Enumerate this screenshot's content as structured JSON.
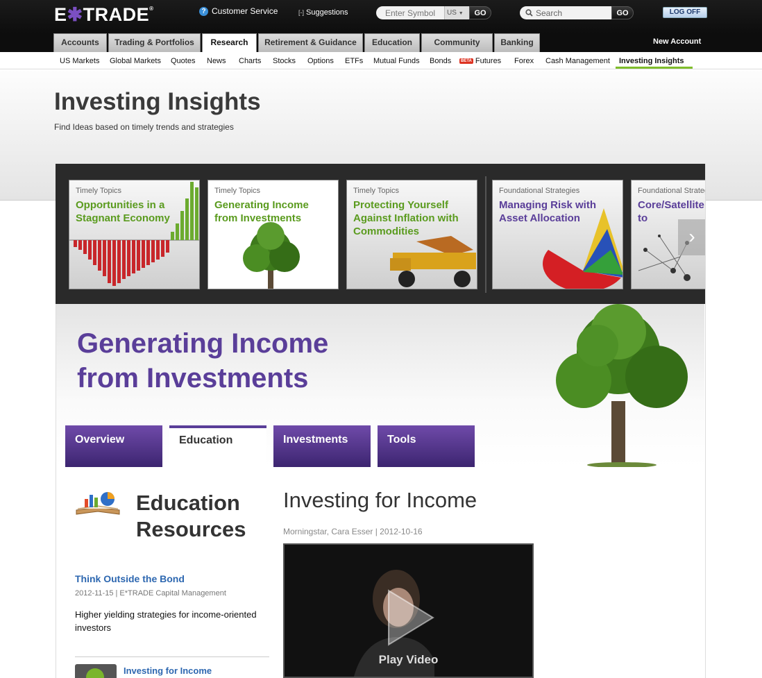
{
  "header": {
    "logo": "E*TRADE",
    "customer_service": "Customer Service",
    "suggestions": "Suggestions",
    "symbol_placeholder": "Enter Symbol",
    "symbol_market": "US",
    "go_label": "GO",
    "search_placeholder": "Search",
    "search_go_label": "GO",
    "logoff_label": "LOG OFF"
  },
  "nav": {
    "tabs": [
      {
        "label": "Accounts"
      },
      {
        "label": "Trading & Portfolios"
      },
      {
        "label": "Research"
      },
      {
        "label": "Retirement & Guidance"
      },
      {
        "label": "Education"
      },
      {
        "label": "Community"
      },
      {
        "label": "Banking"
      }
    ],
    "new_account": "New Account",
    "active_tab": "Research"
  },
  "subnav": {
    "items": [
      {
        "label": "US Markets"
      },
      {
        "label": "Global Markets"
      },
      {
        "label": "Quotes"
      },
      {
        "label": "News"
      },
      {
        "label": "Charts"
      },
      {
        "label": "Stocks"
      },
      {
        "label": "Options"
      },
      {
        "label": "ETFs"
      },
      {
        "label": "Mutual Funds"
      },
      {
        "label": "Bonds"
      },
      {
        "label": "Futures",
        "badge": "BETA"
      },
      {
        "label": "Forex"
      },
      {
        "label": "Cash Management"
      },
      {
        "label": "Investing Insights"
      }
    ],
    "active_item": "Investing Insights"
  },
  "page": {
    "title": "Investing Insights",
    "subtitle": "Find Ideas based on timely trends and strategies"
  },
  "carousel": {
    "cards": [
      {
        "kicker": "Timely Topics",
        "title": "Opportunities in a Stagnant Economy",
        "color": "#5a9b1e"
      },
      {
        "kicker": "Timely Topics",
        "title": "Generating Income from Investments",
        "color": "#5a9b1e"
      },
      {
        "kicker": "Timely Topics",
        "title": "Protecting Yourself Against Inflation with Commodities",
        "color": "#5a9b1e"
      },
      {
        "kicker": "Foundational Strategies",
        "title": "Managing Risk with Asset Allocation",
        "color": "#5a3e99"
      },
      {
        "kicker": "Foundational Strategies",
        "title": "Core/Satellite Approach to",
        "color": "#5a3e99"
      }
    ]
  },
  "feature": {
    "title": "Generating Income from Investments",
    "tabs": [
      {
        "label": "Overview"
      },
      {
        "label": "Education"
      },
      {
        "label": "Investments"
      },
      {
        "label": "Tools"
      }
    ],
    "active_tab": "Education"
  },
  "education": {
    "heading_line1": "Education",
    "heading_line2": "Resources",
    "items": [
      {
        "title": "Think Outside the Bond",
        "meta": "2012-11-15 | E*TRADE Capital Management",
        "description": "Higher yielding strategies for income-oriented investors"
      },
      {
        "title": "Investing for Income"
      }
    ]
  },
  "article": {
    "title": "Investing for Income",
    "meta": "Morningstar, Cara Esser | 2012-10-16",
    "video_label": "Play Video"
  },
  "colors": {
    "brand_purple": "#5a3e99",
    "green": "#5a9b1e",
    "link_blue": "#2d67b0"
  }
}
